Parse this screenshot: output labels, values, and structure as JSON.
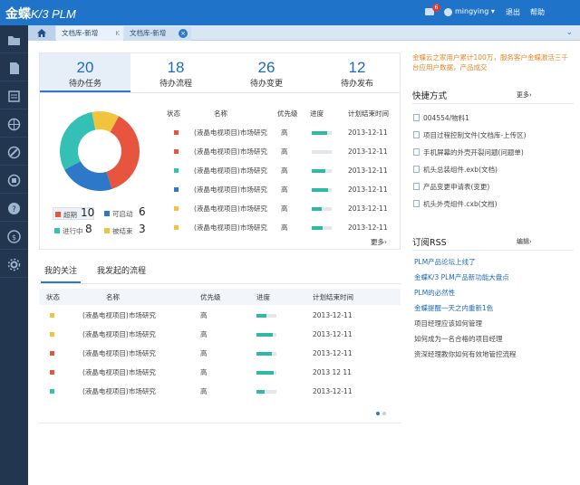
{
  "app": {
    "logo_main": "金蝶",
    "logo_sub": "K/3 PLM",
    "mail_badge": "6",
    "user": "mingying",
    "user_caret": "▾",
    "logout": "退出",
    "help": "帮助"
  },
  "tabs": {
    "home_icon": "home-icon",
    "items": [
      {
        "label": "文档库-新增",
        "close": "K"
      },
      {
        "label": "文档库-新增",
        "close": "×"
      }
    ],
    "more": "⌄"
  },
  "sidebar": {
    "icons": [
      "folder-icon",
      "document-icon",
      "list-icon",
      "compass-icon",
      "tools-icon",
      "report-icon",
      "help-icon",
      "dollar-icon",
      "settings-icon"
    ]
  },
  "kpis": [
    {
      "value": "20",
      "label": "待办任务"
    },
    {
      "value": "18",
      "label": "待办流程"
    },
    {
      "value": "26",
      "label": "待办变更"
    },
    {
      "value": "12",
      "label": "待办发布"
    }
  ],
  "task_chart": {
    "chart_data": {
      "type": "pie",
      "segments": [
        {
          "name": "超期",
          "value": 10,
          "color": "#e8553e"
        },
        {
          "name": "可启动",
          "value": 6,
          "color": "#2d78c8"
        },
        {
          "name": "进行中",
          "value": 8,
          "color": "#34c0b4"
        },
        {
          "name": "被结束",
          "value": 3,
          "color": "#f2c33c"
        }
      ]
    }
  },
  "task_table": {
    "headers": [
      "状态",
      "名称",
      "优先级",
      "进度",
      "计划结束时间"
    ],
    "rows": [
      {
        "color": "#e8553e",
        "name": "(液晶电视项目)市场研究",
        "priority": "高",
        "progress": 0.75,
        "date": "2013-12-11"
      },
      {
        "color": "#e8553e",
        "name": "(液晶电视项目)市场研究",
        "priority": "高",
        "progress": 0.0,
        "date": "2013-12-11"
      },
      {
        "color": "#34c0b4",
        "name": "(液晶电视项目)市场研究",
        "priority": "高",
        "progress": 0.7,
        "date": "2013-12-11"
      },
      {
        "color": "#2d78c8",
        "name": "(液晶电视项目)市场研究",
        "priority": "高",
        "progress": 0.8,
        "date": "2013-12-11"
      },
      {
        "color": "#f2c33c",
        "name": "(液晶电视项目)市场研究",
        "priority": "高",
        "progress": 0.5,
        "date": "2013-12-11"
      },
      {
        "color": "#f2c33c",
        "name": "(液晶电视项目)市场研究",
        "priority": "高",
        "progress": 0.55,
        "date": "2013-12-11"
      }
    ],
    "more": "更多›"
  },
  "follow": {
    "tabs": [
      "我的关注",
      "我发起的流程"
    ],
    "headers": [
      "状态",
      "名称",
      "优先级",
      "进度",
      "计划结束时间"
    ],
    "rows": [
      {
        "color": "#f2c33c",
        "name": "(液晶电视项目)市场研究",
        "priority": "高",
        "progress": 0.5,
        "date": "2013-12-11"
      },
      {
        "color": "#f2c33c",
        "name": "(液晶电视项目)市场研究",
        "priority": "高",
        "progress": 0.8,
        "date": "2013-12-11"
      },
      {
        "color": "#e8553e",
        "name": "(液晶电视项目)市场研究",
        "priority": "高",
        "progress": 0.75,
        "date": "2013-12-11"
      },
      {
        "color": "#e8553e",
        "name": "(液晶电视项目)市场研究",
        "priority": "高",
        "progress": 0.85,
        "date": "2013 12 11"
      },
      {
        "color": "#34c0b4",
        "name": "(液晶电视项目)市场研究",
        "priority": "高",
        "progress": 0.4,
        "date": "2013-12-11"
      }
    ]
  },
  "notice": "金蝶云之家用户累计100万，服务客户金蝶激活三千台应用户数据，产品成交",
  "quick": {
    "title": "快捷方式",
    "more": "更多›",
    "items": [
      "004554/物料1",
      "项目过程控制文件(文档库-上传区)",
      "手机屏幕的外壳开裂问题(问题单)",
      "机头总装组件.exb(文档)",
      "产品变更申请表(变更)",
      "机头外壳组件.cxb(文档)"
    ]
  },
  "rss": {
    "title": "订阅RSS",
    "more": "编辑›",
    "items": [
      {
        "text": "PLM产品论坛上线了",
        "style": "blue"
      },
      {
        "text": "金蝶K/3 PLM产品新功能大盘点",
        "style": "blue"
      },
      {
        "text": "PLM的必然性",
        "style": "blue"
      },
      {
        "text": "金蝶提醒一天之内重新1色",
        "style": "blue"
      },
      {
        "text": "项目经理应该如何管理",
        "style": "dark"
      },
      {
        "text": "如何成为一名合格的项目经理",
        "style": "dark"
      },
      {
        "text": "资深经理教你如何有效地管控流程",
        "style": "dark"
      }
    ]
  }
}
